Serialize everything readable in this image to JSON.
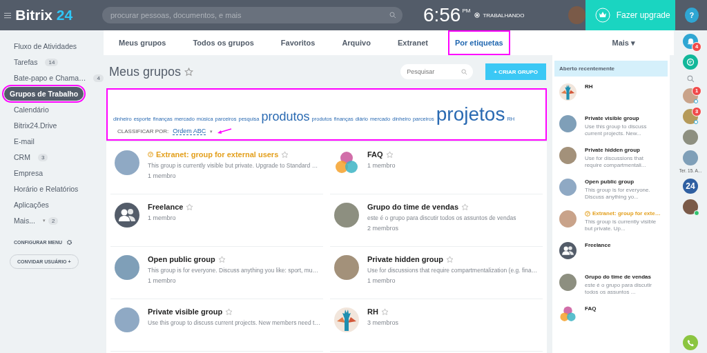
{
  "header": {
    "logo_name": "Bitrix",
    "logo_number": "24",
    "search": {
      "placeholder": "procurar pessoas, documentos, e mais"
    },
    "time": "6:56",
    "ampm": "PM",
    "status": "TRABALHANDO",
    "upgrade": "Fazer upgrade",
    "help": "?"
  },
  "sidebar": {
    "items": [
      {
        "label": "Fluxo de Atividades",
        "selected": false,
        "highlighted": false,
        "kind": "link"
      },
      {
        "label": "Tarefas",
        "count": "14",
        "selected": false,
        "highlighted": false,
        "kind": "link"
      },
      {
        "label": "Bate-papo e Chama…",
        "count": "4",
        "selected": false,
        "highlighted": false,
        "kind": "link"
      },
      {
        "label": "Grupos de Trabalho",
        "selected": true,
        "highlighted": true,
        "kind": "link"
      },
      {
        "label": "Calendário",
        "selected": false,
        "highlighted": false,
        "kind": "link"
      },
      {
        "label": "Bitrix24.Drive",
        "selected": false,
        "highlighted": false,
        "kind": "link"
      },
      {
        "label": "E-mail",
        "selected": false,
        "highlighted": false,
        "kind": "link"
      },
      {
        "label": "CRM",
        "count": "3",
        "selected": false,
        "highlighted": false,
        "kind": "link"
      },
      {
        "label": "Empresa",
        "selected": false,
        "highlighted": false,
        "kind": "link"
      },
      {
        "label": "Horário e Relatórios",
        "selected": false,
        "highlighted": false,
        "kind": "link"
      },
      {
        "label": "Aplicações",
        "selected": false,
        "highlighted": false,
        "kind": "link"
      },
      {
        "label": "Mais...",
        "caret": "▾",
        "count": "2",
        "selected": false,
        "highlighted": false,
        "kind": "more"
      }
    ],
    "configure": "CONFIGURAR MENU",
    "invite": "CONVIDAR USUÁRIO",
    "invite_icon": "+"
  },
  "tabs": {
    "items": [
      {
        "label": "Meus grupos",
        "selected": false,
        "highlighted": false
      },
      {
        "label": "Todos os grupos",
        "selected": false,
        "highlighted": false
      },
      {
        "label": "Favoritos",
        "selected": false,
        "highlighted": false
      },
      {
        "label": "Arquivo",
        "selected": false,
        "highlighted": false
      },
      {
        "label": "Extranet",
        "selected": false,
        "highlighted": false
      },
      {
        "label": "Por etiquetas",
        "selected": true,
        "highlighted": true
      }
    ],
    "more": "Mais",
    "more_caret": "▾"
  },
  "page": {
    "title": "Meus grupos",
    "search": {
      "placeholder": "Pesquisar"
    },
    "create_icon": "+",
    "create_button": "CRIAR GRUPO"
  },
  "tag_cloud": {
    "highlighted": true,
    "tags": [
      {
        "text": "dinheiro",
        "kind": "small"
      },
      {
        "text": "esporte",
        "kind": "small"
      },
      {
        "text": "finanças",
        "kind": "small"
      },
      {
        "text": "mercado",
        "kind": "small"
      },
      {
        "text": "música",
        "kind": "small"
      },
      {
        "text": "parceiros",
        "kind": "small"
      },
      {
        "text": "pesquisa",
        "kind": "small"
      },
      {
        "text": "produtos",
        "kind": "large"
      },
      {
        "text": "produtos",
        "kind": "small"
      },
      {
        "text": "finanças",
        "kind": "small"
      },
      {
        "text": "diário",
        "kind": "small"
      },
      {
        "text": "mercado",
        "kind": "small"
      },
      {
        "text": "dinheiro",
        "kind": "small"
      },
      {
        "text": "parceiros",
        "kind": "small"
      },
      {
        "text": "projetos",
        "kind": "xlarge"
      },
      {
        "text": "RH",
        "kind": "small"
      }
    ],
    "sort_label": "CLASSIFICAR POR:",
    "sort_value": "Ordem ABC",
    "sort_caret": "▾",
    "annotated": true
  },
  "groups": [
    {
      "name": "Extranet: group for external users",
      "kind": "extranet",
      "avatar": {
        "kind": "photo"
      },
      "description": "This group is currently visible but private. Upgrade to Standard …",
      "members": "1 membro"
    },
    {
      "name": "FAQ",
      "kind": "normal",
      "avatar": {
        "kind": "bubbles"
      },
      "members": "1 membro"
    },
    {
      "name": "Freelance",
      "kind": "normal",
      "avatar": {
        "kind": "people"
      },
      "members": "1 membro"
    },
    {
      "name": "Grupo do time de vendas",
      "kind": "normal",
      "avatar": {
        "kind": "photo"
      },
      "description": "este é o grupo para discutir todos os assuntos de vendas",
      "members": "2 membros"
    },
    {
      "name": "Open public group",
      "kind": "normal",
      "avatar": {
        "kind": "photo"
      },
      "description": "This group is for everyone. Discuss anything you like: sport, mu…",
      "members": "1 membro"
    },
    {
      "name": "Private hidden group",
      "kind": "normal",
      "avatar": {
        "kind": "photo"
      },
      "description": "Use for discussions that require compartmentalization (e.g. fina…",
      "members": "1 membro"
    },
    {
      "name": "Private visible group",
      "kind": "normal",
      "avatar": {
        "kind": "photo"
      },
      "description": "Use this group to discuss current projects. New members need t…"
    },
    {
      "name": "RH",
      "kind": "normal",
      "avatar": {
        "kind": "hands"
      },
      "members": "3 membros"
    }
  ],
  "recent": {
    "title": "Aberto recentemente",
    "items": [
      {
        "name": "RH",
        "kind": "normal",
        "avatar": {
          "kind": "hands"
        }
      },
      {
        "name": "Private visible group",
        "kind": "normal",
        "avatar": {
          "kind": "photo"
        },
        "description": "Use this group to discuss current projects. New..."
      },
      {
        "name": "Private hidden group",
        "kind": "normal",
        "avatar": {
          "kind": "photo"
        },
        "description": "Use for discussions that require compartmentali..."
      },
      {
        "name": "Open public group",
        "kind": "normal",
        "avatar": {
          "kind": "photo"
        },
        "description": "This group is for everyone. Discuss anything yo..."
      },
      {
        "name": "Extranet: group for exte…",
        "kind": "extranet",
        "avatar": {
          "kind": "photo"
        },
        "description": "This group is currently visible but private. Up..."
      },
      {
        "name": "Freelance",
        "kind": "normal",
        "avatar": {
          "kind": "people"
        }
      },
      {
        "name": "Grupo do time de vendas",
        "kind": "normal",
        "avatar": {
          "kind": "photo"
        },
        "description": "este é o grupo para discutir todos os assuntos ..."
      },
      {
        "name": "FAQ",
        "kind": "normal",
        "avatar": {
          "kind": "bubbles"
        }
      }
    ]
  },
  "rail": {
    "notifications": "4",
    "chats": [
      {
        "badge": "1",
        "kind": "group"
      },
      {
        "badge": "3",
        "kind": "group"
      },
      {
        "kind": "user"
      },
      {
        "kind": "user"
      }
    ],
    "date": "Ter. 15. A...",
    "logo": "24"
  }
}
